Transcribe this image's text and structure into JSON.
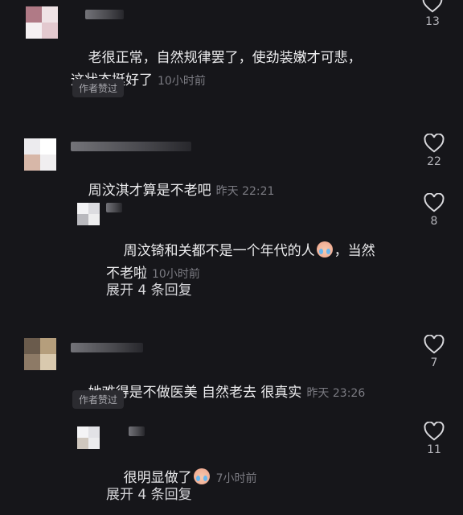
{
  "comments": [
    {
      "text_line1": "老很正常，自然规律罢了，使劲装嫩才可悲，",
      "text_line2": "这状态挺好了",
      "time": "10小时前",
      "badge": "作者赞过",
      "likes": "13"
    },
    {
      "text": "周汶淇才算是不老吧",
      "time": "昨天 22:21",
      "likes": "22",
      "reply": {
        "text_line1a": "周汶锜和关都不是一个年代的人",
        "text_line1b": "，当然",
        "text_line2": "不老啦",
        "time": "10小时前",
        "likes": "8"
      },
      "expand": "展开 4 条回复"
    },
    {
      "text": "她难得是不做医美 自然老去 很真实",
      "time": "昨天 23:26",
      "badge": "作者赞过",
      "likes": "7",
      "reply": {
        "text": "很明显做了",
        "time": "7小时前",
        "likes": "11"
      },
      "expand": "展开 4 条回复"
    }
  ],
  "icons": {
    "like": "heart-outline-icon",
    "emoji": "crying-face-emoji"
  },
  "colors": {
    "background": "#16161a",
    "text": "#ececee",
    "meta": "#7b7b82"
  }
}
